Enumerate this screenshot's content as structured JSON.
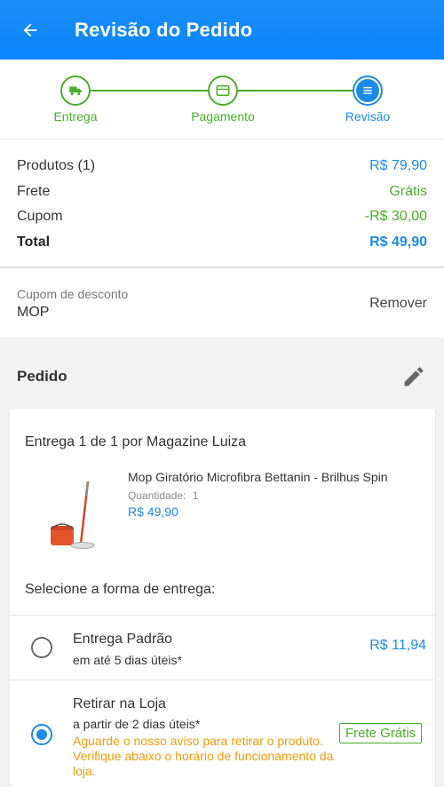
{
  "header": {
    "title": "Revisão do Pedido",
    "back_icon": "arrow-left-icon"
  },
  "stepper": {
    "steps": [
      {
        "label": "Entrega",
        "icon": "truck-icon",
        "color": "#4aad2a"
      },
      {
        "label": "Pagamento",
        "icon": "credit-card-icon",
        "color": "#4aad2a"
      },
      {
        "label": "Revisão",
        "icon": "list-icon",
        "color": "#1a8be8"
      }
    ]
  },
  "summary": {
    "produtos_label": "Produtos (1)",
    "produtos_value": "R$ 79,90",
    "frete_label": "Frete",
    "frete_value": "Grátis",
    "cupom_label": "Cupom",
    "cupom_value": "-R$ 30,00",
    "total_label": "Total",
    "total_value": "R$ 49,90"
  },
  "coupon": {
    "caption": "Cupom de desconto",
    "code": "MOP",
    "remove_label": "Remover"
  },
  "pedido": {
    "title": "Pedido",
    "edit_icon": "pencil-icon",
    "entrega_title": "Entrega 1 de 1 por Magazine Luiza",
    "product": {
      "name": "Mop Giratório Microfibra Bettanin - Brilhus Spin",
      "qty_label": "Quantidade:",
      "qty_value": "1",
      "price": "R$ 49,90"
    },
    "select_label": "Selecione a forma de entrega:",
    "options": [
      {
        "title": "Entrega Padrão",
        "subtitle": "em até 5 dias úteis*",
        "price": "R$ 11,94",
        "selected": false
      },
      {
        "title": "Retirar na Loja",
        "subtitle": "a partir de 2 dias úteis*",
        "warning": "Aguarde o nosso aviso para retirar o produto. Verifique abaixo o horário de funcionamento da loja.",
        "badge": "Frete Grátis",
        "selected": true
      }
    ]
  },
  "colors": {
    "primary": "#0a86fd",
    "green": "#4aad2a",
    "price_blue": "#1a8be8",
    "warning": "#f29b0c"
  }
}
